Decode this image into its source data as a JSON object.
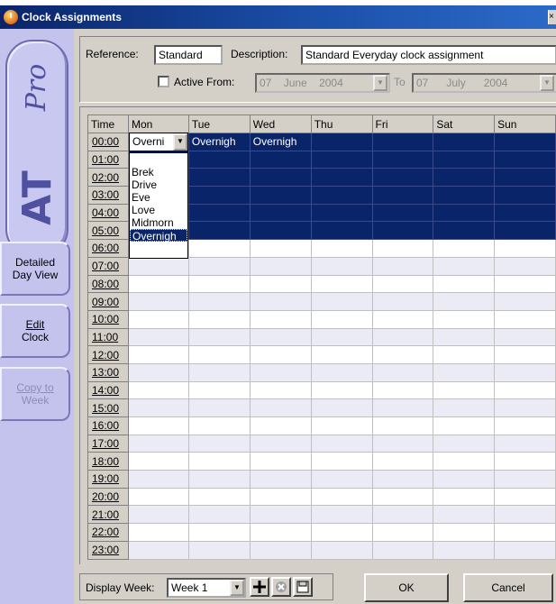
{
  "window": {
    "title": "Clock Assignments",
    "close_glyph": "×"
  },
  "icons": {
    "app": "clock-icon",
    "add": "plus-icon",
    "remove": "delete-icon",
    "save": "save-icon",
    "dropdown": "chevron-down-icon"
  },
  "sidebar": {
    "logo_pro": "Pro",
    "logo_at": "AT",
    "buttons": [
      {
        "label_line1": "Detailed",
        "label_line2": "Day View",
        "enabled": true
      },
      {
        "label_line1": "Edit",
        "label_line2": "Clock",
        "enabled": true
      },
      {
        "label_line1": "Copy to",
        "label_line2": "Week",
        "enabled": false
      }
    ]
  },
  "header": {
    "reference_label": "Reference:",
    "reference_value": "Standard",
    "description_label": "Description:",
    "description_value": "Standard Everyday clock assignment",
    "active_from_label": "Active From:",
    "active_from_checked": false,
    "from_day": "07",
    "from_month": "June",
    "from_year": "2004",
    "to_label": "To",
    "to_day": "07",
    "to_month": "July",
    "to_year": "2004"
  },
  "grid": {
    "columns": [
      "Time",
      "Mon",
      "Tue",
      "Wed",
      "Thu",
      "Fri",
      "Sat",
      "Sun"
    ],
    "rows": [
      {
        "time": "00:00",
        "cells": [
          "",
          "Overnigh",
          "Overnigh",
          "",
          "",
          "",
          ""
        ]
      },
      {
        "time": "01:00",
        "cells": [
          "",
          "",
          "",
          "",
          "",
          "",
          ""
        ]
      },
      {
        "time": "02:00",
        "cells": [
          "",
          "",
          "",
          "",
          "",
          "",
          ""
        ]
      },
      {
        "time": "03:00",
        "cells": [
          "",
          "",
          "",
          "",
          "",
          "",
          ""
        ]
      },
      {
        "time": "04:00",
        "cells": [
          "",
          "",
          "",
          "",
          "",
          "",
          ""
        ]
      },
      {
        "time": "05:00",
        "cells": [
          "",
          "",
          "",
          "",
          "",
          "",
          ""
        ]
      },
      {
        "time": "06:00",
        "cells": [
          "",
          "",
          "",
          "",
          "",
          "",
          ""
        ]
      },
      {
        "time": "07:00",
        "cells": [
          "",
          "",
          "",
          "",
          "",
          "",
          ""
        ]
      },
      {
        "time": "08:00",
        "cells": [
          "",
          "",
          "",
          "",
          "",
          "",
          ""
        ]
      },
      {
        "time": "09:00",
        "cells": [
          "",
          "",
          "",
          "",
          "",
          "",
          ""
        ]
      },
      {
        "time": "10:00",
        "cells": [
          "",
          "",
          "",
          "",
          "",
          "",
          ""
        ]
      },
      {
        "time": "11:00",
        "cells": [
          "",
          "",
          "",
          "",
          "",
          "",
          ""
        ]
      },
      {
        "time": "12:00",
        "cells": [
          "",
          "",
          "",
          "",
          "",
          "",
          ""
        ]
      },
      {
        "time": "13:00",
        "cells": [
          "",
          "",
          "",
          "",
          "",
          "",
          ""
        ]
      },
      {
        "time": "14:00",
        "cells": [
          "",
          "",
          "",
          "",
          "",
          "",
          ""
        ]
      },
      {
        "time": "15:00",
        "cells": [
          "",
          "",
          "",
          "",
          "",
          "",
          ""
        ]
      },
      {
        "time": "16:00",
        "cells": [
          "",
          "",
          "",
          "",
          "",
          "",
          ""
        ]
      },
      {
        "time": "17:00",
        "cells": [
          "",
          "",
          "",
          "",
          "",
          "",
          ""
        ]
      },
      {
        "time": "18:00",
        "cells": [
          "",
          "",
          "",
          "",
          "",
          "",
          ""
        ]
      },
      {
        "time": "19:00",
        "cells": [
          "",
          "",
          "",
          "",
          "",
          "",
          ""
        ]
      },
      {
        "time": "20:00",
        "cells": [
          "",
          "",
          "",
          "",
          "",
          "",
          ""
        ]
      },
      {
        "time": "21:00",
        "cells": [
          "",
          "",
          "",
          "",
          "",
          "",
          ""
        ]
      },
      {
        "time": "22:00",
        "cells": [
          "",
          "",
          "",
          "",
          "",
          "",
          ""
        ]
      },
      {
        "time": "23:00",
        "cells": [
          "",
          "",
          "",
          "",
          "",
          "",
          ""
        ]
      }
    ],
    "selected_rows": [
      "00:00",
      "01:00",
      "02:00",
      "03:00",
      "04:00",
      "05:00"
    ],
    "mon_editor_value": "Overni",
    "mon_options": [
      "",
      "Brek",
      "Drive",
      "Eve",
      "Love",
      "Midmorn",
      "Overnigh"
    ],
    "mon_selected_option": "Overnigh"
  },
  "footer": {
    "display_week_label": "Display Week:",
    "week_value": "Week 1",
    "ok_label": "OK",
    "cancel_label": "Cancel"
  },
  "colors": {
    "selection": "#0a246a",
    "sidebar": "#c3c3ee",
    "logo": "#5050a0",
    "dialog": "#d4d0c8"
  }
}
